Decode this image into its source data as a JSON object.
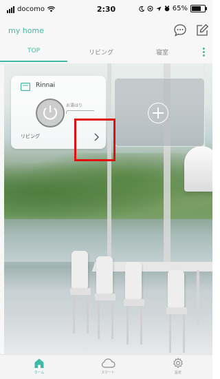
{
  "status_bar": {
    "carrier": "docomo",
    "time": "2:30",
    "battery": "65%"
  },
  "header": {
    "home_name": "my home",
    "chat_icon": "chat-bubble-icon",
    "edit_icon": "edit-icon"
  },
  "tabs": [
    {
      "label": "TOP",
      "active": true
    },
    {
      "label": "リビング",
      "active": false
    },
    {
      "label": "寝室",
      "active": false
    }
  ],
  "device_card": {
    "name": "Rinnai",
    "status_label": "お湯はり",
    "room": "リビング",
    "icon": "water-heater-icon"
  },
  "add_card": {
    "icon": "plus-icon"
  },
  "bottom_nav": [
    {
      "label": "ホーム",
      "icon": "home-icon",
      "active": true
    },
    {
      "label": "スマート",
      "icon": "cloud-icon",
      "active": false
    },
    {
      "label": "設定",
      "icon": "gear-icon",
      "active": false
    }
  ],
  "colors": {
    "accent": "#3fb9a6",
    "highlight": "#e01010"
  }
}
